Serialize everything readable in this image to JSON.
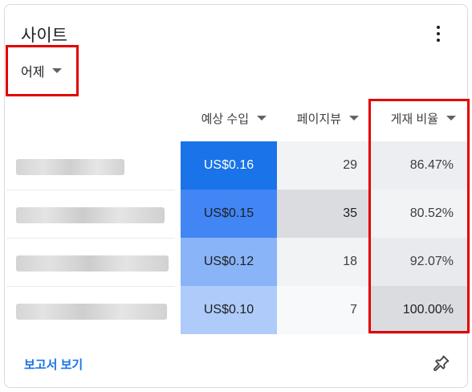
{
  "card": {
    "title": "사이트",
    "menu_icon": "more-vert-icon",
    "period": "어제",
    "columns": [
      {
        "label": "예상 수입",
        "icon": "caret-down-icon"
      },
      {
        "label": "페이지뷰",
        "icon": "caret-down-icon"
      },
      {
        "label": "게재 비율",
        "icon": "caret-down-icon"
      }
    ],
    "rows": [
      {
        "earnings": "US$0.16",
        "pageviews": "29",
        "rate": "86.47%"
      },
      {
        "earnings": "US$0.15",
        "pageviews": "35",
        "rate": "80.52%"
      },
      {
        "earnings": "US$0.12",
        "pageviews": "18",
        "rate": "92.07%"
      },
      {
        "earnings": "US$0.10",
        "pageviews": "7",
        "rate": "100.00%"
      }
    ],
    "footer": {
      "report_label": "보고서 보기",
      "pin_icon": "pin-icon"
    }
  },
  "colors": {
    "accent": "#1a73e8",
    "highlight": "#e30000",
    "earn_scale": [
      "#1a73e8",
      "#4285f4",
      "#8ab4f8",
      "#aecbfa"
    ]
  }
}
